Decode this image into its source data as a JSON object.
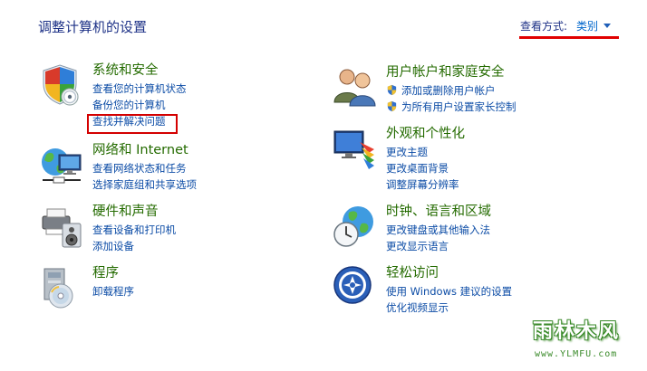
{
  "header": {
    "title": "调整计算机的设置",
    "view_by_label": "查看方式:",
    "view_by_value": "类别"
  },
  "categories": [
    {
      "key": "system",
      "icon": "system-security-icon",
      "title": "系统和安全",
      "links": [
        "查看您的计算机状态",
        "备份您的计算机",
        "查找并解决问题"
      ]
    },
    {
      "key": "network",
      "icon": "network-internet-icon",
      "title": "网络和 Internet",
      "links": [
        "查看网络状态和任务",
        "选择家庭组和共享选项"
      ]
    },
    {
      "key": "hardware",
      "icon": "hardware-sound-icon",
      "title": "硬件和声音",
      "links": [
        "查看设备和打印机",
        "添加设备"
      ]
    },
    {
      "key": "programs",
      "icon": "programs-icon",
      "title": "程序",
      "links": [
        "卸载程序"
      ]
    },
    {
      "key": "users",
      "icon": "user-accounts-icon",
      "title": "用户帐户和家庭安全",
      "links": [
        "添加或删除用户帐户",
        "为所有用户设置家长控制"
      ]
    },
    {
      "key": "appearance",
      "icon": "appearance-icon",
      "title": "外观和个性化",
      "links": [
        "更改主题",
        "更改桌面背景",
        "调整屏幕分辨率"
      ]
    },
    {
      "key": "clock",
      "icon": "clock-language-region-icon",
      "title": "时钟、语言和区域",
      "links": [
        "更改键盘或其他输入法",
        "更改显示语言"
      ]
    },
    {
      "key": "ease",
      "icon": "ease-of-access-icon",
      "title": "轻松访问",
      "links": [
        "使用 Windows 建议的设置",
        "优化视频显示"
      ]
    }
  ],
  "watermark": {
    "name": "雨林木风",
    "url": "www.YLMFU.com"
  },
  "colors": {
    "category_title": "#246b00",
    "link": "#0c4ca6",
    "annotation_red": "#d40000"
  }
}
